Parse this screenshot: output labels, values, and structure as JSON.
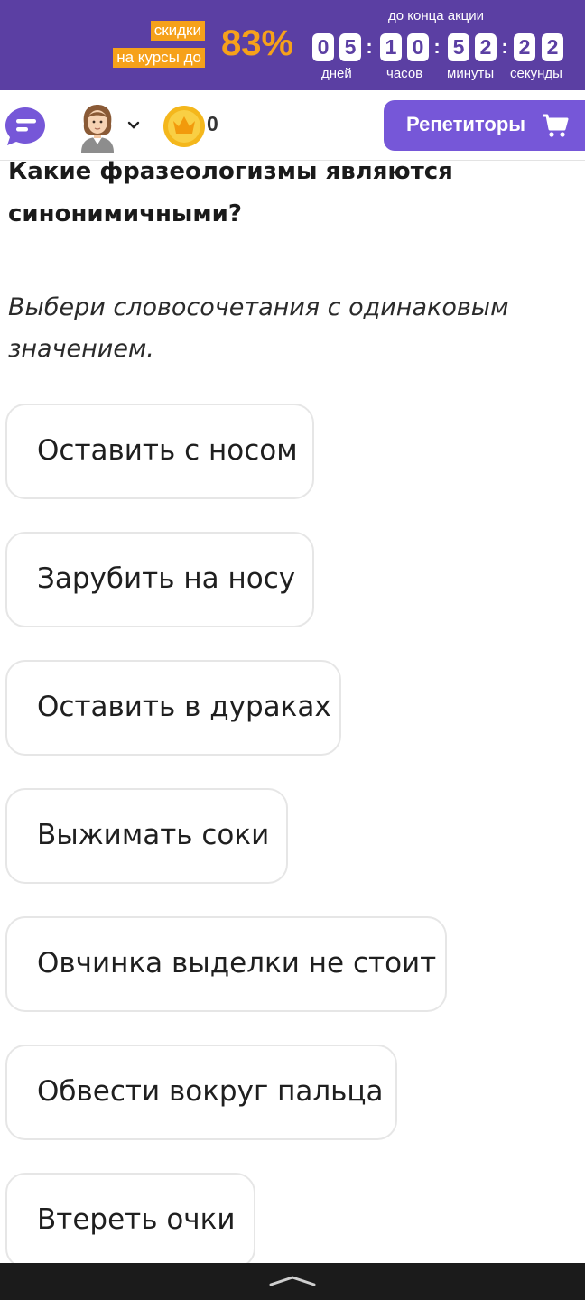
{
  "promo": {
    "label_line1": "скидки",
    "label_line2": "на курсы до",
    "percent": "83%",
    "countdown_title": "до конца акции",
    "digits": {
      "days": [
        "0",
        "5"
      ],
      "hours": [
        "1",
        "0"
      ],
      "minutes": [
        "5",
        "2"
      ],
      "seconds": [
        "2",
        "2"
      ]
    },
    "units": {
      "days": "дней",
      "hours": "часов",
      "minutes": "минуты",
      "seconds": "секунды"
    },
    "colors": {
      "background": "#5b3fa3",
      "accent": "#f6a11a"
    }
  },
  "header": {
    "menu_icon": "chat-menu-icon",
    "avatar_icon": "user-avatar-icon",
    "coin_icon": "crown-coin-icon",
    "coin_count": "0",
    "tutors_button": "Репетиторы",
    "cart_icon": "cart-icon",
    "accent_color": "#7657d8"
  },
  "question": {
    "title": "Какие фразеологизмы являются синонимичными?",
    "instruction": "Выбери словосочетания с одинаковым значением."
  },
  "options": [
    "Оставить с носом",
    "Зарубить на носу",
    "Оставить в дураках",
    "Выжимать соки",
    "Овчинка выделки не стоит",
    "Обвести вокруг пальца",
    "Втереть очки"
  ],
  "system_nav": {
    "icon": "chevron-up-icon"
  }
}
